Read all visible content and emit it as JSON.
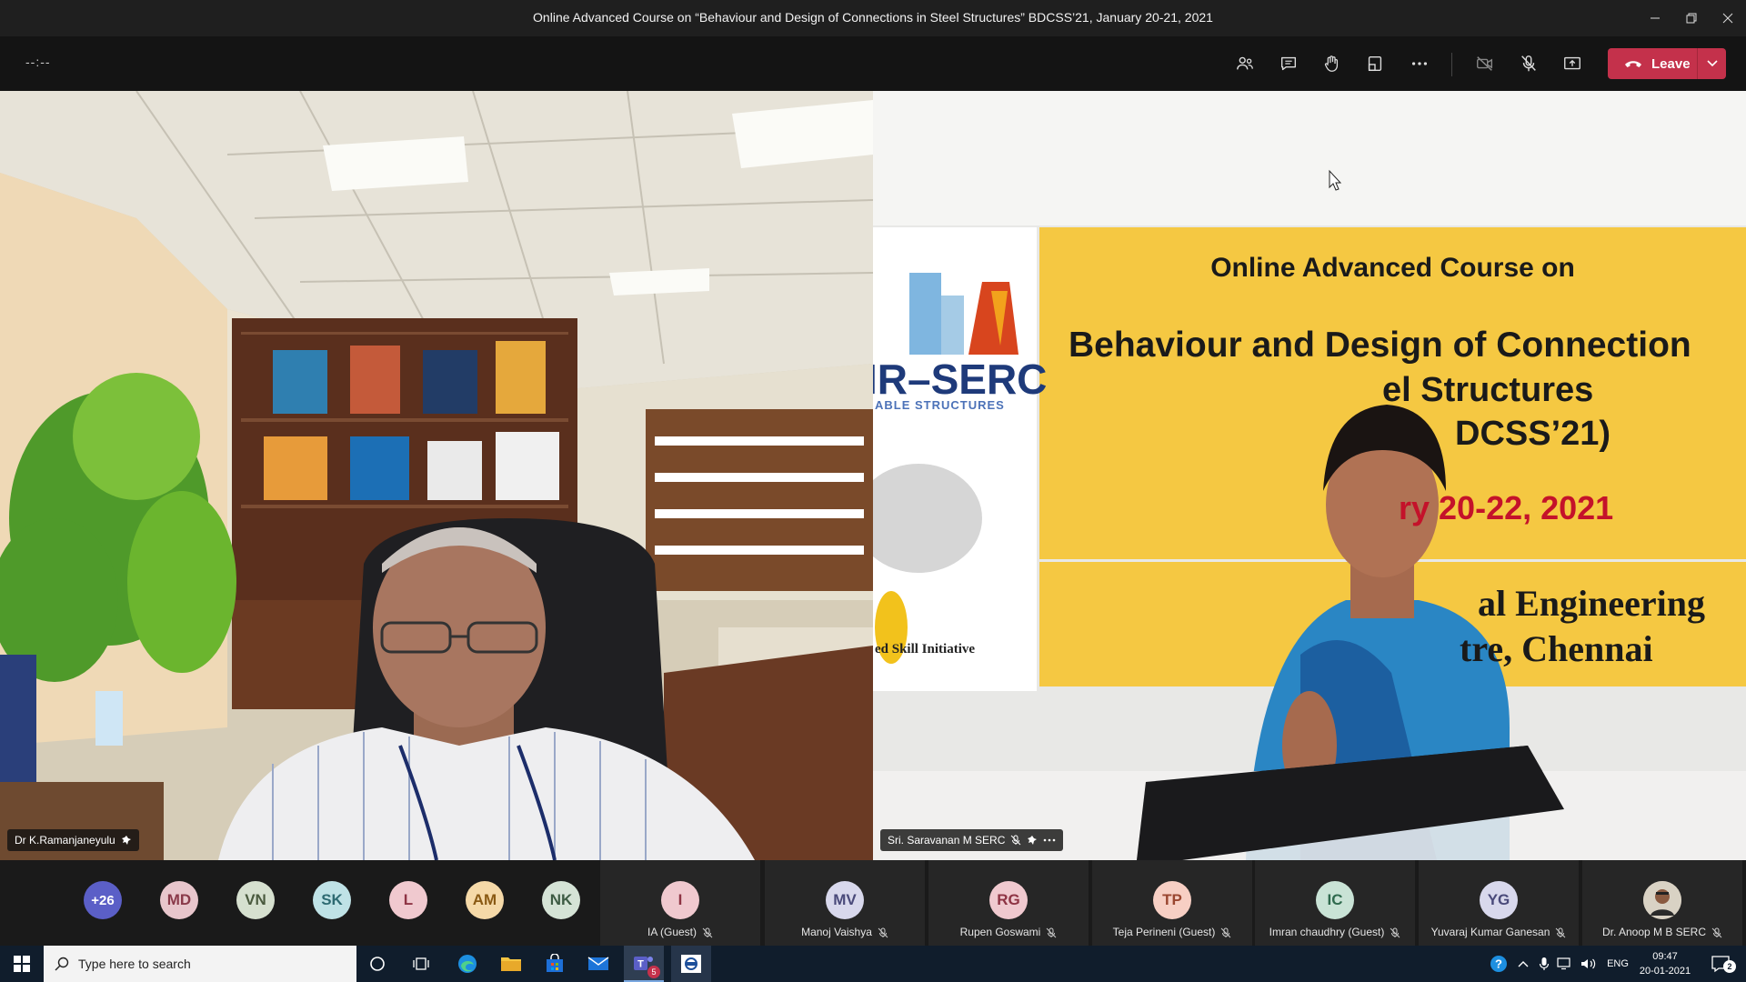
{
  "window": {
    "title": "Online Advanced Course on “Behaviour and Design of Connections in Steel Structures” BDCSS’21, January 20-21, 2021"
  },
  "toolbar": {
    "timer": "--:--",
    "leave_label": "Leave"
  },
  "videos": {
    "left_name": "Dr K.Ramanjaneyulu",
    "right_name": "Sri. Saravanan M SERC"
  },
  "slide": {
    "line1": "Online Advanced Course on",
    "line2": "Behaviour and Design of Connection",
    "line3": "el Structures",
    "line4": "DCSS’21)",
    "line5": "ry 20-22, 2021",
    "line6": "al Engineering",
    "line7": "tre, Chennai",
    "logo_text": "IR–SERC",
    "logo_sub": "ABLE STRUCTURES",
    "left_caption": "ed Skill Initiative"
  },
  "participants_overflow": {
    "more_label": "+26",
    "avatars": [
      {
        "initials": "MD",
        "color": "#e8c6cc",
        "text": "#8a3a4a"
      },
      {
        "initials": "VN",
        "color": "#d6e0cf",
        "text": "#4a5a3e"
      },
      {
        "initials": "SK",
        "color": "#bfe2e6",
        "text": "#2e6a72"
      },
      {
        "initials": "L",
        "color": "#f0c9cf",
        "text": "#8e3444"
      },
      {
        "initials": "AM",
        "color": "#f5d9a8",
        "text": "#8a5a14"
      },
      {
        "initials": "NK",
        "color": "#d5e3d6",
        "text": "#3e5c44"
      }
    ]
  },
  "participants": [
    {
      "initials": "I",
      "name": "IA (Guest)",
      "color": "#f0c9cf",
      "text": "#8e3444"
    },
    {
      "initials": "MV",
      "name": "Manoj Vaishya",
      "color": "#d8d8ec",
      "text": "#4a4a7a"
    },
    {
      "initials": "RG",
      "name": "Rupen Goswami",
      "color": "#f0c9cf",
      "text": "#8e3444"
    },
    {
      "initials": "TP",
      "name": "Teja Perineni (Guest)",
      "color": "#f7cfc4",
      "text": "#9a4630"
    },
    {
      "initials": "IC",
      "name": "Imran chaudhry (Guest)",
      "color": "#c9e3d6",
      "text": "#2f6a4e"
    },
    {
      "initials": "YG",
      "name": "Yuvaraj Kumar Ganesan",
      "color": "#d8d8ec",
      "text": "#4a4a7a"
    },
    {
      "initials": "",
      "name": "Dr. Anoop M B SERC",
      "color": "#c4b7a6",
      "text": "#333"
    }
  ],
  "taskbar": {
    "search_placeholder": "Type here to search",
    "teams_badge": "5",
    "language": "ENG",
    "time": "09:47",
    "date": "20-01-2021",
    "notification_count": "2"
  }
}
